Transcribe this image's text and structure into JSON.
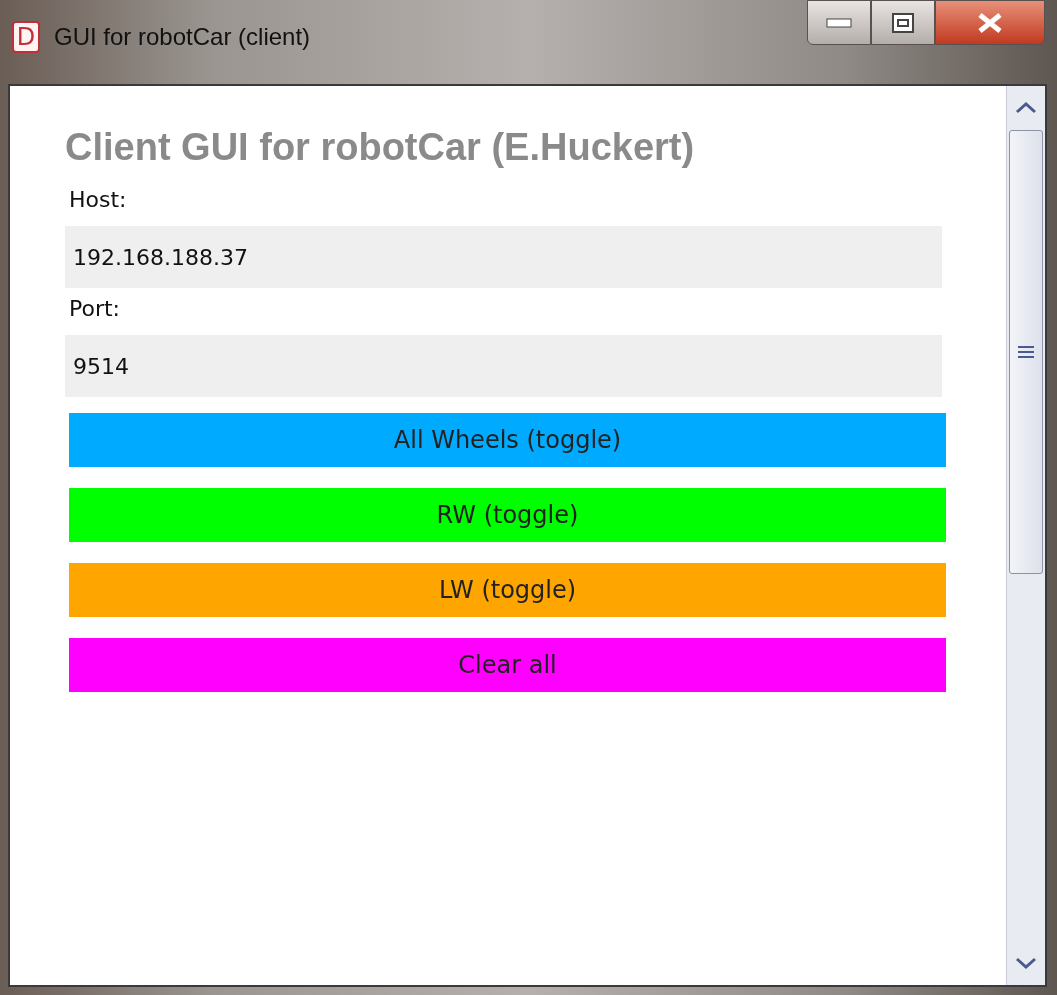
{
  "window": {
    "title": "GUI for robotCar (client)",
    "icon": "D"
  },
  "heading": "Client GUI for robotCar (E.Huckert)",
  "fields": [
    {
      "label": "Host:",
      "value": "192.168.188.37"
    },
    {
      "label": "Port:",
      "value": "9514"
    }
  ],
  "buttons": [
    {
      "label": "All Wheels (toggle)",
      "color": "#00aaff"
    },
    {
      "label": "RW (toggle)",
      "color": "#00ff00"
    },
    {
      "label": "LW (toggle)",
      "color": "#ffa500"
    },
    {
      "label": "Clear all",
      "color": "#ff00ff"
    }
  ]
}
